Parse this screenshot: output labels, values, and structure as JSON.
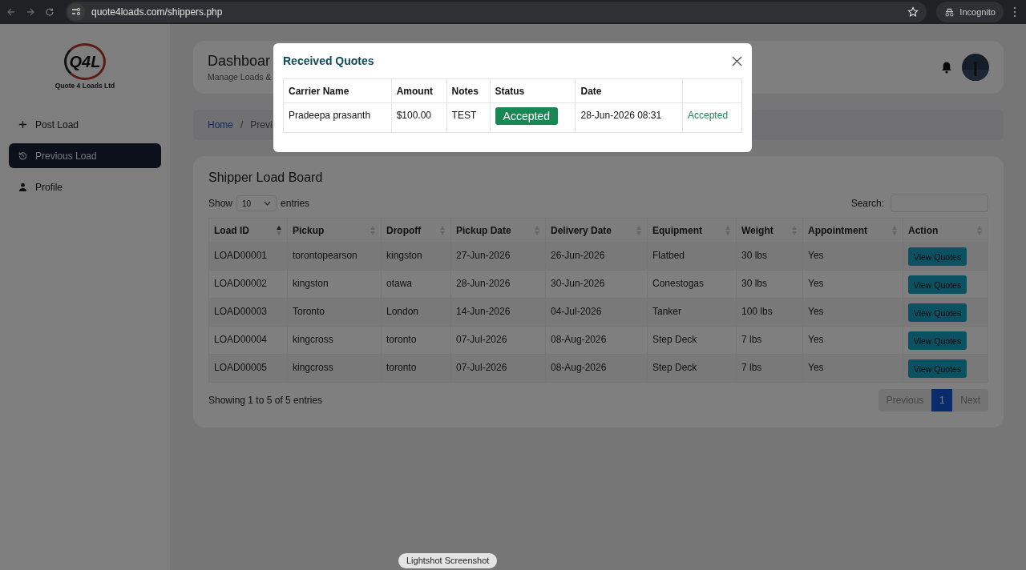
{
  "browser": {
    "url": "quote4loads.com/shippers.php",
    "profile_label": "Incognito"
  },
  "sidebar": {
    "logo_mark": "Q4L",
    "company": "Quote 4 Loads Ltd",
    "items": [
      {
        "label": "Post Load",
        "selected": false
      },
      {
        "label": "Previous Load",
        "selected": true
      },
      {
        "label": "Profile",
        "selected": false
      }
    ]
  },
  "header": {
    "title": "Dashboar",
    "subtitle": "Manage Loads &"
  },
  "breadcrumb": [
    {
      "label": "Home",
      "kind": "link"
    },
    {
      "label": "/",
      "kind": "separator"
    },
    {
      "label": "Previ",
      "kind": "current"
    }
  ],
  "board": {
    "title": "Shipper Load Board",
    "show_label": "Show",
    "page_length": "10",
    "entries_label": "entries",
    "search_label": "Search:",
    "columns": [
      {
        "label": "Load ID",
        "sorted": true
      },
      {
        "label": "Pickup",
        "sorted": false
      },
      {
        "label": "Dropoff",
        "sorted": false
      },
      {
        "label": "Pickup Date",
        "sorted": false
      },
      {
        "label": "Delivery Date",
        "sorted": false
      },
      {
        "label": "Equipment",
        "sorted": false
      },
      {
        "label": "Weight",
        "sorted": false
      },
      {
        "label": "Appointment",
        "sorted": false
      },
      {
        "label": "Action",
        "sorted": false
      }
    ],
    "rows": [
      {
        "cells": [
          "LOAD00001",
          "torontopearson",
          "kingston",
          "27-Jun-2026",
          "26-Jun-2026",
          "Flatbed",
          "30 lbs",
          "Yes"
        ],
        "action": "View Quotes"
      },
      {
        "cells": [
          "LOAD00002",
          "kingston",
          "otawa",
          "28-Jun-2026",
          "30-Jun-2026",
          "Conestogas",
          "30 lbs",
          "Yes"
        ],
        "action": "View Quotes"
      },
      {
        "cells": [
          "LOAD00003",
          "Toronto",
          "London",
          "14-Jun-2026",
          "04-Jul-2026",
          "Tanker",
          "100 lbs",
          "Yes"
        ],
        "action": "View Quotes"
      },
      {
        "cells": [
          "LOAD00004",
          "kingcross",
          "toronto",
          "07-Jul-2026",
          "08-Aug-2026",
          "Step Deck",
          "7 lbs",
          "Yes"
        ],
        "action": "View Quotes"
      },
      {
        "cells": [
          "LOAD00005",
          "kingcross",
          "toronto",
          "07-Jul-2026",
          "08-Aug-2026",
          "Step Deck",
          "7 lbs",
          "Yes"
        ],
        "action": "View Quotes"
      }
    ],
    "info": "Showing 1 to 5 of 5 entries",
    "pagination": [
      {
        "label": "Previous",
        "selected": false,
        "disabled": true
      },
      {
        "label": "1",
        "selected": true,
        "disabled": false
      },
      {
        "label": "Next",
        "selected": false,
        "disabled": true
      }
    ]
  },
  "modal": {
    "title": "Received Quotes",
    "columns": [
      "Carrier Name",
      "Amount",
      "Notes",
      "Status",
      "Date"
    ],
    "rows": [
      {
        "carrier": "Pradeepa prasanth",
        "amount": "$100.00",
        "notes": "TEST",
        "status": "Accepted",
        "date": "28-Jun-2026 08:31",
        "column_6": "Accepted"
      }
    ]
  },
  "tooltip": "Lightshot Screenshot"
}
